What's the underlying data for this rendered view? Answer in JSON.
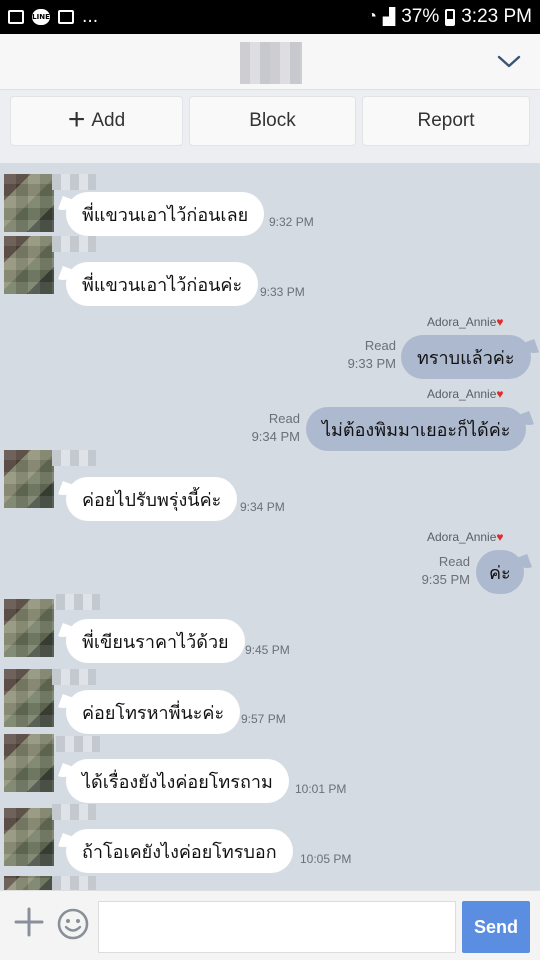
{
  "status_bar": {
    "line_badge": "LINE",
    "dots": "...",
    "battery": "37%",
    "time": "3:23 PM"
  },
  "header": {
    "chevron_icon": "chevron-down-icon"
  },
  "actions": {
    "add_label": "Add",
    "block_label": "Block",
    "report_label": "Report"
  },
  "messages": [
    {
      "dir": "in",
      "text": "พี่แขวนเอาไว้ก่อนเลย",
      "time": "9:32 PM"
    },
    {
      "dir": "in",
      "text": "พี่แขวนเอาไว้ก่อนค่ะ",
      "time": "9:33 PM"
    },
    {
      "dir": "out",
      "sticker": "Adora_Annie",
      "text": "ทราบแล้วค่ะ",
      "read": "Read",
      "time": "9:33 PM"
    },
    {
      "dir": "out",
      "sticker": "Adora_Annie",
      "text": "ไม่ต้องพิมมาเยอะก็ได้ค่ะ",
      "read": "Read",
      "time": "9:34 PM"
    },
    {
      "dir": "in",
      "text": "ค่อยไปรับพรุ่งนี้ค่ะ",
      "time": "9:34 PM"
    },
    {
      "dir": "out",
      "sticker": "Adora_Annie",
      "text": "ค่ะ",
      "read": "Read",
      "time": "9:35 PM"
    },
    {
      "dir": "in",
      "text": "พี่เขียนราคาไว้ด้วย",
      "time": "9:45 PM"
    },
    {
      "dir": "in",
      "text": "ค่อยโทรหาพี่นะค่ะ",
      "time": "9:57 PM"
    },
    {
      "dir": "in",
      "text": "ได้เรื่องยังไงค่อยโทรถาม",
      "time": "10:01 PM"
    },
    {
      "dir": "in",
      "text": "ถ้าโอเคยังไงค่อยโทรบอก",
      "time": "10:05 PM"
    }
  ],
  "heart": "♥",
  "composer": {
    "send_label": "Send"
  },
  "colors": {
    "chat_bg": "#d5dbe3",
    "outgoing_bubble": "#adb9ce",
    "send_button": "#5b8ee0"
  }
}
